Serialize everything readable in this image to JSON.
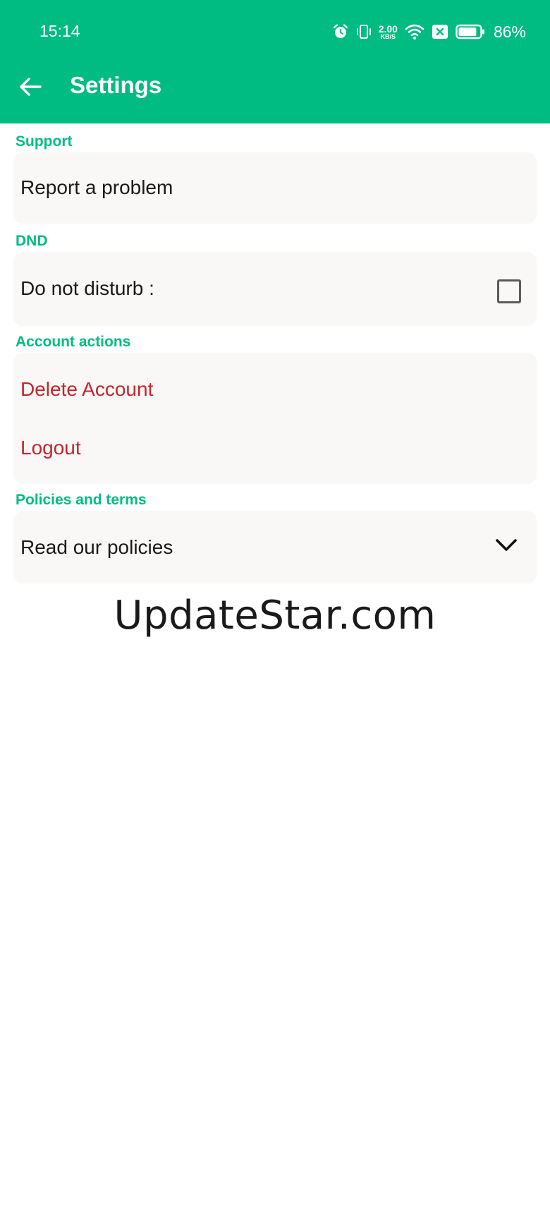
{
  "status_bar": {
    "time": "15:14",
    "net_speed_value": "2.00",
    "net_speed_unit": "KB/S",
    "battery_percent": "86%",
    "battery_level": 0.86,
    "icons": [
      "alarm-icon",
      "vibrate-icon",
      "wifi-icon",
      "sim-off-icon",
      "battery-icon"
    ]
  },
  "toolbar": {
    "title": "Settings",
    "back_icon": "arrow-left-icon"
  },
  "sections": {
    "support": {
      "label": "Support",
      "items": {
        "report": "Report a problem"
      }
    },
    "dnd": {
      "label": "DND",
      "items": {
        "do_not_disturb": "Do not disturb :"
      },
      "checked": false
    },
    "account": {
      "label": "Account actions",
      "items": {
        "delete": "Delete Account",
        "logout": "Logout"
      }
    },
    "policies": {
      "label": "Policies and terms",
      "items": {
        "read": "Read our policies"
      },
      "expand_icon": "chevron-down-icon"
    }
  },
  "watermark": "UpdateStar.com",
  "colors": {
    "accent": "#00BC82",
    "danger": "#C0272D",
    "card_bg": "#FAF8F7",
    "text": "#1A1A1A"
  }
}
